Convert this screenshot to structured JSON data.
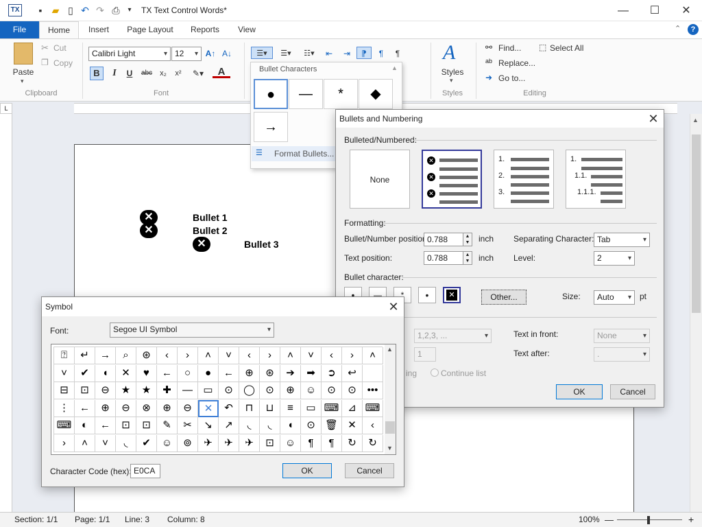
{
  "window": {
    "title": "TX Text Control Words*",
    "app_icon": "TX",
    "controls": [
      "—",
      "☐",
      "✕"
    ]
  },
  "quick_access": [
    "save-icon",
    "open-icon",
    "new-icon",
    "undo-icon",
    "redo-icon",
    "print-icon",
    "customize-icon"
  ],
  "ribbon_tabs": [
    {
      "label": "File"
    },
    {
      "label": "Home",
      "active": true
    },
    {
      "label": "Insert"
    },
    {
      "label": "Page Layout"
    },
    {
      "label": "Reports"
    },
    {
      "label": "View"
    }
  ],
  "ribbon": {
    "clipboard": {
      "label": "Clipboard",
      "paste": "Paste",
      "cut": "Cut",
      "copy": "Copy"
    },
    "font": {
      "label": "Font",
      "family": "Calibri Light",
      "size": "12",
      "bold": "B",
      "italic": "I",
      "underline": "U",
      "strike": "abc"
    },
    "bullet_chars_title": "Bullet Characters",
    "format_bullets": "Format Bullets...",
    "styles": {
      "label": "Styles",
      "button": "Styles"
    },
    "editing": {
      "label": "Editing",
      "find": "Find...",
      "replace": "Replace...",
      "goto": "Go to...",
      "select_all": "Select All"
    }
  },
  "bullet_chars": [
    "●",
    "—",
    "*",
    "◆",
    "→"
  ],
  "document": {
    "bullets": [
      "Bullet 1",
      "Bullet 2",
      "Bullet 3"
    ],
    "bullet_glyph": "✕"
  },
  "bullets_dialog": {
    "title": "Bullets and Numbering",
    "section_type": "Bulleted/Numbered:",
    "none_label": "None",
    "num_labels": [
      "1.",
      "2.",
      "3."
    ],
    "multi_labels": [
      "1.",
      "1.1.",
      "1.1.1."
    ],
    "section_format": "Formatting:",
    "bullet_pos_label": "Bullet/Number position:",
    "bullet_pos": "0.788",
    "text_pos_label": "Text position:",
    "text_pos": "0.788",
    "unit": "inch",
    "sep_char_label": "Separating Character:",
    "sep_char": "Tab",
    "level_label": "Level:",
    "level": "2",
    "section_bullet": "Bullet character:",
    "bullet_options": [
      "•",
      "—",
      "*",
      "•",
      "✕"
    ],
    "other": "Other...",
    "size_label": "Size:",
    "size": "Auto",
    "size_unit": "pt",
    "numbering_format": "1,2,3, ...",
    "start_at": "1",
    "text_front_label": "Text in front:",
    "text_front": "None",
    "text_after_label": "Text after:",
    "text_after": ".",
    "restart_label": "ing",
    "continue_label": "Continue list",
    "ok": "OK",
    "cancel": "Cancel"
  },
  "symbol_dialog": {
    "title": "Symbol",
    "font_label": "Font:",
    "font": "Segoe UI Symbol",
    "code_label": "Character Code (hex):",
    "code": "E0CA",
    "ok": "OK",
    "cancel": "Cancel",
    "grid": [
      [
        "⍰",
        "↵",
        "→",
        "⌕",
        "⊛",
        "‹",
        "›",
        "˄",
        "˅",
        "‹",
        "›",
        "˄",
        "˅",
        "‹",
        "›",
        "˄"
      ],
      [
        "˅",
        "✔",
        "◖",
        "✕",
        "♥",
        "←",
        "○",
        "●",
        "←",
        "⊕",
        "⊛",
        "➔",
        "➡",
        "➲",
        "↩",
        ""
      ],
      [
        "⊟",
        "⊡",
        "⊖",
        "★",
        "★",
        "✚",
        "—",
        "▭",
        "⊙",
        "◯",
        "⊙",
        "⊕",
        "☺",
        "⊙",
        "⊙",
        "•••"
      ],
      [
        "⋮",
        "←",
        "⊕",
        "⊖",
        "⊗",
        "⊕",
        "⊖",
        "✕",
        "↶",
        "⊓",
        "⊔",
        "≡",
        "▭",
        "⌨",
        "⊿",
        "⌨"
      ],
      [
        "⌨",
        "◐",
        "←",
        "⊡",
        "⊡",
        "✎",
        "✂",
        "↘",
        "↗",
        "◟",
        "◟",
        "◖",
        "⊙",
        "🗑",
        "✕",
        "‹"
      ],
      [
        "›",
        "˄",
        "˅",
        "◟",
        "✔",
        "☺",
        "⊚",
        "✈",
        "✈",
        "✈",
        "⊡",
        "☺",
        "¶",
        "¶",
        "↻",
        "↻"
      ]
    ]
  },
  "status": {
    "section": "Section: 1/1",
    "page": "Page: 1/1",
    "line": "Line: 3",
    "column": "Column: 8",
    "zoom": "100%"
  }
}
